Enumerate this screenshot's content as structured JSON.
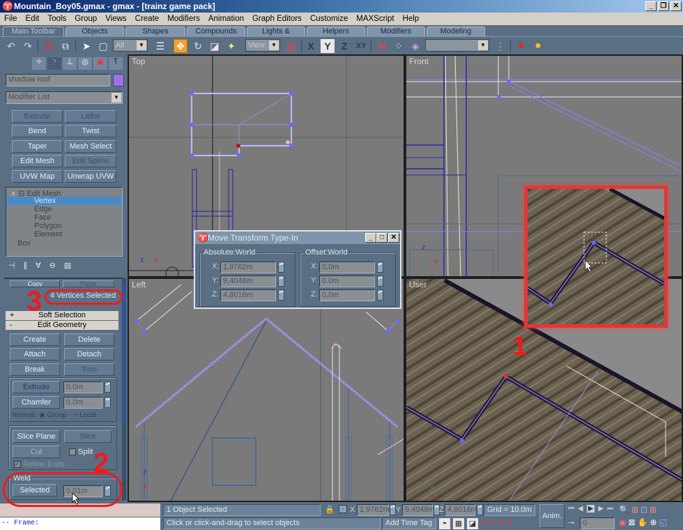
{
  "window": {
    "title": "Mountain_Boy05.gmax - gmax - [trainz game pack]",
    "controls": [
      "_",
      "❐",
      "✕"
    ]
  },
  "menu": [
    "File",
    "Edit",
    "Tools",
    "Group",
    "Views",
    "Create",
    "Modifiers",
    "Animation",
    "Graph Editors",
    "Customize",
    "MAXScript",
    "Help"
  ],
  "tabs": [
    "Main Toolbar",
    "Objects",
    "Shapes",
    "Compounds",
    "Lights & Cameras",
    "Helpers",
    "Modifiers",
    "Modeling"
  ],
  "toolbar": {
    "selection_filter": "All",
    "ref_coord": "View",
    "named_selection": "",
    "axis_labels": {
      "x": "X",
      "y": "Y",
      "z": "Z",
      "xy": "XY"
    }
  },
  "command_panel": {
    "object_name": "shadow roof",
    "object_color": "#a070e8",
    "modifier_list_label": "Modifier List",
    "modifier_buttons": [
      {
        "label": "Extrude",
        "enabled": false
      },
      {
        "label": "Lathe",
        "enabled": false
      },
      {
        "label": "Bend",
        "enabled": true
      },
      {
        "label": "Twist",
        "enabled": true
      },
      {
        "label": "Taper",
        "enabled": true
      },
      {
        "label": "Mesh Select",
        "enabled": true
      },
      {
        "label": "Edit Mesh",
        "enabled": true
      },
      {
        "label": "Edit Spline",
        "enabled": false
      },
      {
        "label": "UVW Map",
        "enabled": true
      },
      {
        "label": "Unwrap UVW",
        "enabled": true
      }
    ],
    "stack": {
      "root": "Edit Mesh",
      "subobjects": [
        "Vertex",
        "Edge",
        "Face",
        "Polygon",
        "Element"
      ],
      "selected": "Vertex",
      "base": "Box"
    },
    "copy_label": "Copy",
    "paste_label": "Paste",
    "selection_status": "4 Vertices Selected",
    "rollouts": {
      "soft_selection": "Soft Selection",
      "edit_geometry": "Edit Geometry"
    },
    "edit_geometry": {
      "create": "Create",
      "delete": "Delete",
      "attach": "Attach",
      "detach": "Detach",
      "break": "Break",
      "turn": "Turn",
      "extrude": "Extrude",
      "extrude_value": "0.0m",
      "chamfer": "Chamfer",
      "chamfer_value": "0.0m",
      "normal_label": "Normal:",
      "group_label": "Group",
      "local_label": "Local",
      "slice_plane": "Slice Plane",
      "slice": "Slice",
      "cut": "Cut",
      "split": "Split",
      "refine_ends": "Refine Ends",
      "weld_group": "Weld",
      "weld_selected": "Selected",
      "weld_threshold": "0.01m"
    }
  },
  "viewports": {
    "top": "Top",
    "front": "Front",
    "left": "Left",
    "user": "User"
  },
  "dialog": {
    "title": "Move Transform Type-In",
    "absolute_label": "Absolute:World",
    "offset_label": "Offset:World",
    "absolute": {
      "x": "1,9762m",
      "y": "9,4048m",
      "z": "4,8016m"
    },
    "offset": {
      "x": "0,0m",
      "y": "0.0m",
      "z": "0,0m"
    }
  },
  "annotations": {
    "one": "1",
    "two": "2",
    "three": "3"
  },
  "status": {
    "listener_text": "-- Frame:",
    "selection": "1 Object Selected",
    "prompt": "Click or click-and-drag to select objects",
    "x": "1,9762m",
    "y": "9,4048m",
    "z": "4,8016m",
    "grid": "Grid = 10.0m",
    "add_time_tag": "Add Time Tag",
    "anim_button": "Anim.",
    "frame_value": "0"
  }
}
